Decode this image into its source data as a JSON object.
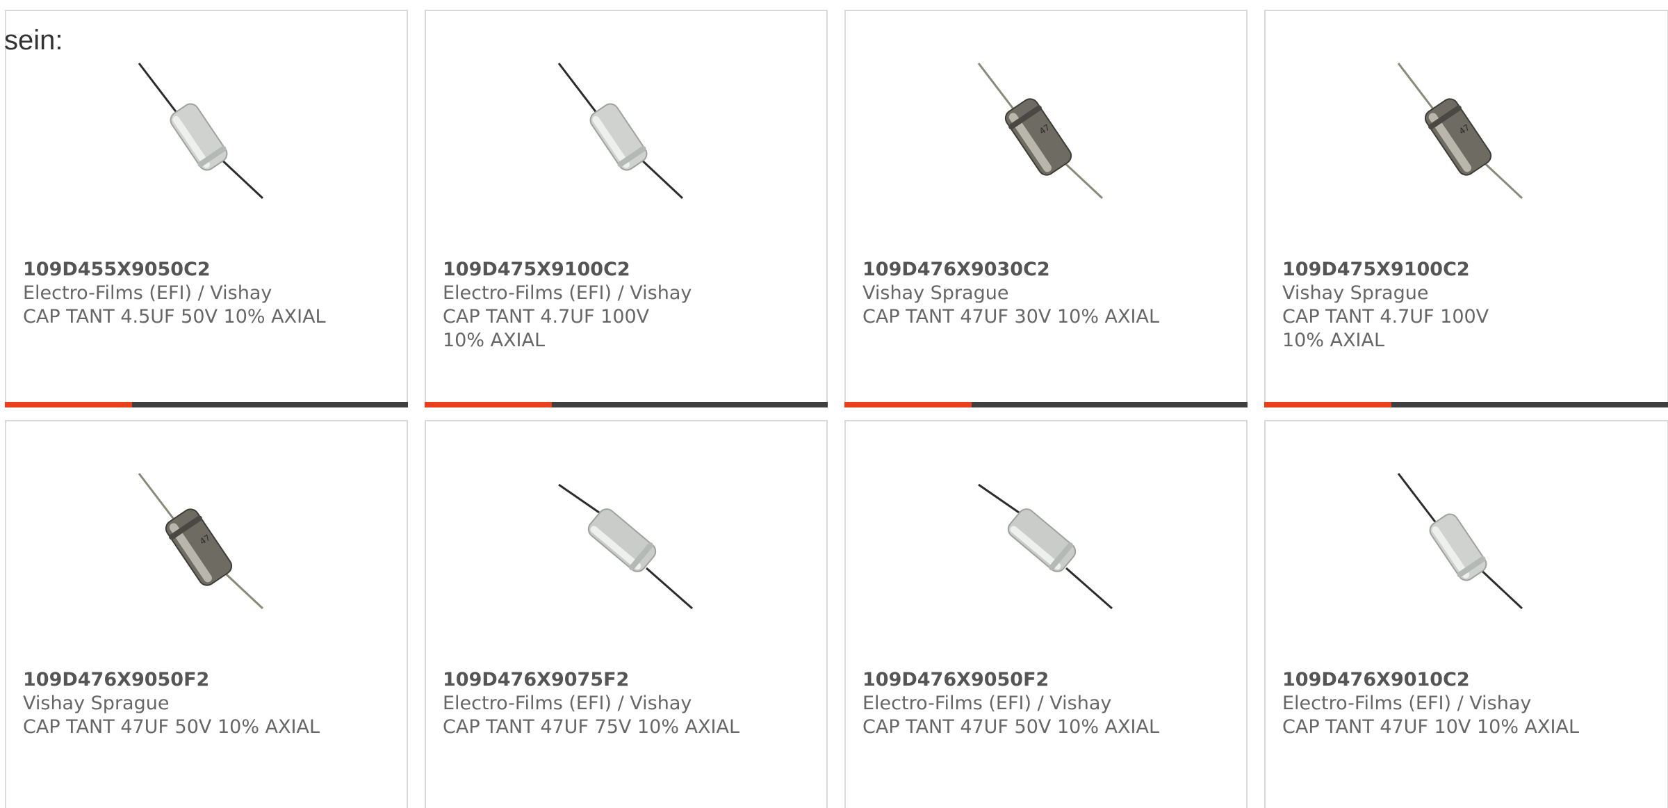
{
  "intro": {
    "text": "sein:"
  },
  "theme": {
    "accent": "#e8401c",
    "bar": "#3f3f3f",
    "border": "#d9d9d9"
  },
  "cards": [
    {
      "part": "109D455X9050C2",
      "manufacturer": "Electro-Films (EFI) / Vishay",
      "description": "CAP TANT 4.5UF 50V 10% AXIAL",
      "image": "capacitor-clear-image",
      "bar": true
    },
    {
      "part": "109D475X9100C2",
      "manufacturer": "Electro-Films (EFI) / Vishay",
      "description": "CAP TANT 4.7UF 100V 10% AXIAL",
      "image": "capacitor-clear-image",
      "bar": true
    },
    {
      "part": "109D476X9030C2",
      "manufacturer": "Vishay Sprague",
      "description": "CAP TANT 47UF 30V 10% AXIAL",
      "image": "capacitor-metal-image",
      "bar": true
    },
    {
      "part": "109D475X9100C2",
      "manufacturer": "Vishay Sprague",
      "description": "CAP TANT 4.7UF 100V 10% AXIAL",
      "image": "capacitor-metal-image",
      "bar": true
    },
    {
      "part": "109D476X9050F2",
      "manufacturer": "Vishay Sprague",
      "description": "CAP TANT 47UF 50V 10% AXIAL",
      "image": "capacitor-metal-image",
      "bar": false
    },
    {
      "part": "109D476X9075F2",
      "manufacturer": "Electro-Films (EFI) / Vishay",
      "description": "CAP TANT 47UF 75V 10% AXIAL",
      "image": "capacitor-clear-image",
      "bar": false
    },
    {
      "part": "109D476X9050F2",
      "manufacturer": "Electro-Films (EFI) / Vishay",
      "description": "CAP TANT 47UF 50V 10% AXIAL",
      "image": "capacitor-clear-image",
      "bar": false
    },
    {
      "part": "109D476X9010C2",
      "manufacturer": "Electro-Films (EFI) / Vishay",
      "description": "CAP TANT 47UF 10V 10% AXIAL",
      "image": "capacitor-clear-image",
      "bar": false
    }
  ]
}
